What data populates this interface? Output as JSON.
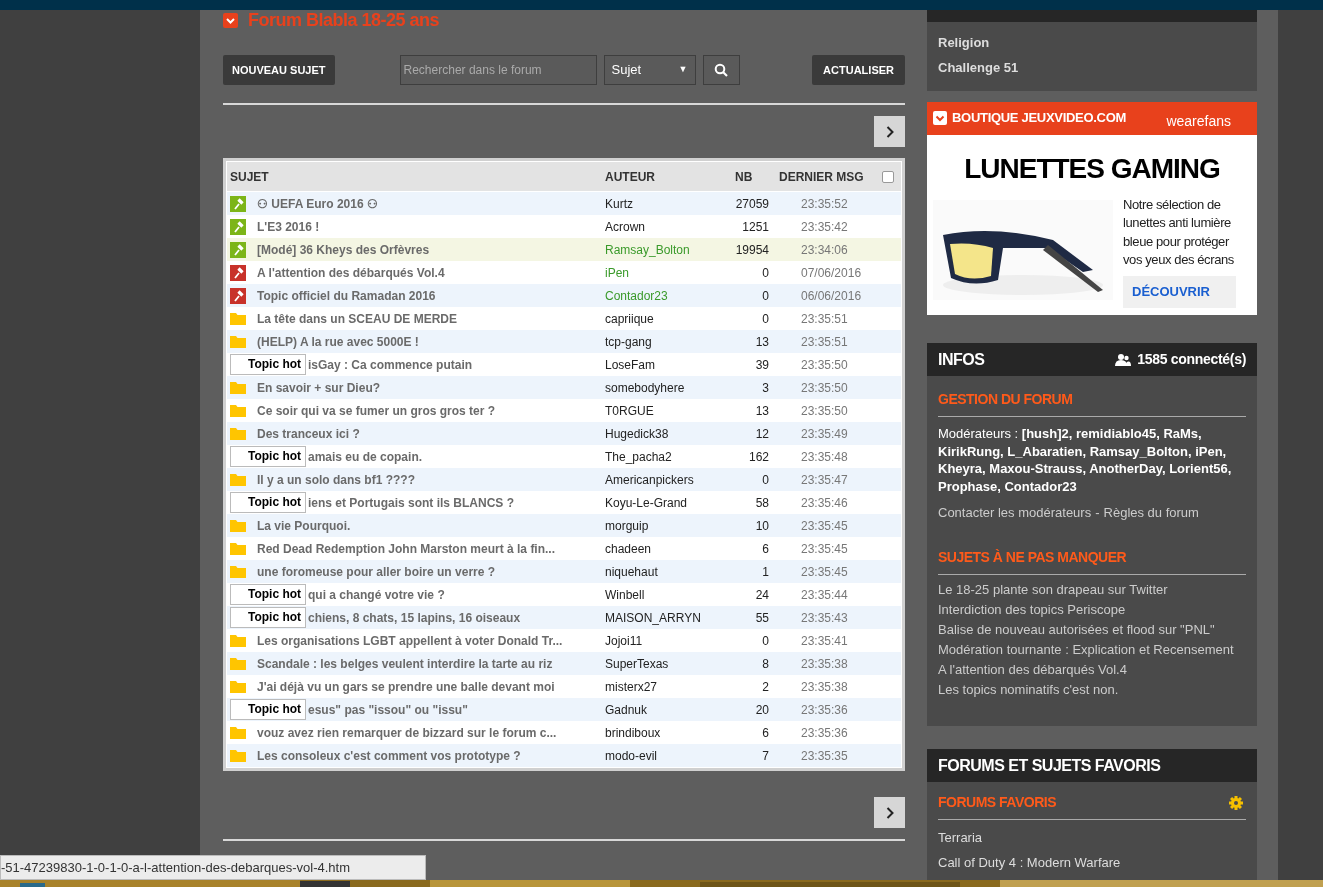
{
  "page_title": "Forum Blabla 18-25 ans",
  "toolbar": {
    "new_topic": "NOUVEAU SUJET",
    "search": {
      "placeholder": "Rechercher dans le forum"
    },
    "select": {
      "value": "Sujet",
      "arrow": "▼"
    },
    "refresh": "ACTUALISER"
  },
  "table": {
    "columns": [
      "SUJET",
      "AUTEUR",
      "NB",
      "DERNIER MSG"
    ],
    "select_all": {
      "checked": false
    },
    "rows": [
      {
        "kind": "pinned_open",
        "title": "⚇ UEFA Euro 2016 ⚇",
        "author": "Kurtz",
        "moderator": false,
        "highlighted": false,
        "count": "27059",
        "last": "23:35:52"
      },
      {
        "kind": "pinned_open",
        "title": "L'E3 2016 !",
        "author": "Acrown",
        "moderator": false,
        "highlighted": false,
        "count": "1251",
        "last": "23:35:42"
      },
      {
        "kind": "pinned_open",
        "title": "[Modé] 36 Kheys des Orfèvres",
        "author": "Ramsay_Bolton",
        "moderator": true,
        "highlighted": true,
        "count": "19954",
        "last": "23:34:06"
      },
      {
        "kind": "pinned_locked",
        "title": "A l'attention des débarqués Vol.4",
        "author": "iPen",
        "moderator": true,
        "highlighted": false,
        "count": "0",
        "last": "07/06/2016"
      },
      {
        "kind": "pinned_locked",
        "title": "Topic officiel du Ramadan 2016",
        "author": "Contador23",
        "moderator": true,
        "highlighted": false,
        "count": "0",
        "last": "06/06/2016"
      },
      {
        "kind": "folder",
        "title": "La tête dans un SCEAU DE MERDE",
        "author": "capriique",
        "moderator": false,
        "highlighted": false,
        "count": "0",
        "last": "23:35:51"
      },
      {
        "kind": "folder",
        "title": "(HELP) A la rue avec 5000E !",
        "author": "tcp-gang",
        "moderator": false,
        "highlighted": false,
        "count": "13",
        "last": "23:35:51"
      },
      {
        "kind": "hot",
        "icon_alt": "Topic hot",
        "title": "isGay : Ca commence putain",
        "author": "LoseFam",
        "moderator": false,
        "highlighted": false,
        "count": "39",
        "last": "23:35:50"
      },
      {
        "kind": "folder",
        "title": "En savoir + sur Dieu?",
        "author": "somebodyhere",
        "moderator": false,
        "highlighted": false,
        "count": "3",
        "last": "23:35:50"
      },
      {
        "kind": "folder",
        "title": "Ce soir qui va se fumer un gros gros ter ?",
        "author": "T0RGUE",
        "moderator": false,
        "highlighted": false,
        "count": "13",
        "last": "23:35:50"
      },
      {
        "kind": "folder",
        "title": "Des tranceux ici ?",
        "author": "Hugedick38",
        "moderator": false,
        "highlighted": false,
        "count": "12",
        "last": "23:35:49"
      },
      {
        "kind": "hot",
        "icon_alt": "Topic hot",
        "title": "amais eu de copain.",
        "author": "The_pacha2",
        "moderator": false,
        "highlighted": false,
        "count": "162",
        "last": "23:35:48"
      },
      {
        "kind": "folder",
        "title": "Il y a un solo dans bf1 ????",
        "author": "Americanpickers",
        "moderator": false,
        "highlighted": false,
        "count": "0",
        "last": "23:35:47"
      },
      {
        "kind": "hot",
        "icon_alt": "Topic hot",
        "title": "iens et Portugais sont ils BLANCS ?",
        "author": "Koyu-Le-Grand",
        "moderator": false,
        "highlighted": false,
        "count": "58",
        "last": "23:35:46"
      },
      {
        "kind": "folder",
        "title": "La vie Pourquoi.",
        "author": "morguip",
        "moderator": false,
        "highlighted": false,
        "count": "10",
        "last": "23:35:45"
      },
      {
        "kind": "folder",
        "title": "Red Dead Redemption John Marston meurt à la fin...",
        "author": "chadeen",
        "moderator": false,
        "highlighted": false,
        "count": "6",
        "last": "23:35:45"
      },
      {
        "kind": "folder",
        "title": "une foromeuse pour aller boire un verre ?",
        "author": "niquehaut",
        "moderator": false,
        "highlighted": false,
        "count": "1",
        "last": "23:35:45"
      },
      {
        "kind": "hot",
        "icon_alt": "Topic hot",
        "title": "qui a changé votre vie ?",
        "author": "Winbell",
        "moderator": false,
        "highlighted": false,
        "count": "24",
        "last": "23:35:44"
      },
      {
        "kind": "hot",
        "icon_alt": "Topic hot",
        "title": "chiens, 8 chats, 15 lapins, 16 oiseaux",
        "author": "MAISON_ARRYN",
        "moderator": false,
        "highlighted": false,
        "count": "55",
        "last": "23:35:43"
      },
      {
        "kind": "folder",
        "title": "Les organisations LGBT appellent à voter Donald Tr...",
        "author": "Jojoi11",
        "moderator": false,
        "highlighted": false,
        "count": "0",
        "last": "23:35:41"
      },
      {
        "kind": "folder",
        "title": "Scandale : les belges veulent interdire la tarte au riz",
        "author": "SuperTexas",
        "moderator": false,
        "highlighted": false,
        "count": "8",
        "last": "23:35:38"
      },
      {
        "kind": "folder",
        "title": "J'ai déjà vu un gars se prendre une balle devant moi",
        "author": "misterx27",
        "moderator": false,
        "highlighted": false,
        "count": "2",
        "last": "23:35:38"
      },
      {
        "kind": "hot",
        "icon_alt": "Topic hot",
        "title": "esus\" pas \"issou\" ou \"issu\"",
        "author": "Gadnuk",
        "moderator": false,
        "highlighted": false,
        "count": "20",
        "last": "23:35:36"
      },
      {
        "kind": "folder",
        "title": "vouz avez rien remarquer de bizzard sur le forum c...",
        "author": "brindiboux",
        "moderator": false,
        "highlighted": false,
        "count": "6",
        "last": "23:35:36"
      },
      {
        "kind": "folder",
        "title": "Les consoleux c'est comment vos prototype ?",
        "author": "modo-evil",
        "moderator": false,
        "highlighted": false,
        "count": "7",
        "last": "23:35:35"
      }
    ]
  },
  "subforums": {
    "items": [
      "Religion",
      "Challenge 51"
    ]
  },
  "ad": {
    "brand": "BOUTIQUE JEUXVIDEO.COM",
    "partner": "wearefans",
    "headline": "LUNETTES GAMING",
    "text": "Notre sélection de lunettes anti lumière bleue pour protéger vos yeux des écrans",
    "cta": "DÉCOUVRIR"
  },
  "infos": {
    "title": "INFOS",
    "online": "1585 connecté(s)",
    "management_heading": "GESTION DU FORUM",
    "moderators": "Modérateurs : **[hush]2, remidiablo45, RaMs, KirikRung, L_Abaratien, Ramsay_Bolton, iPen, Kheyra, Maxou-Strauss, AnotherDay, Lorient56, Prophase, Contador23**",
    "contact": "Contacter les modérateurs",
    "separator": "-",
    "rules": "Règles du forum",
    "must_read_heading": "SUJETS À NE PAS MANQUER",
    "must_read": [
      "Le 18-25 plante son drapeau sur Twitter",
      "Interdiction des topics Periscope",
      "Balise de nouveau autorisées et flood sur \"PNL\"",
      "Modération tournante : Explication et Recensement",
      "A l'attention des débarqués Vol.4",
      "Les topics nominatifs c'est non."
    ]
  },
  "favorites": {
    "title": "FORUMS ET SUJETS FAVORIS",
    "forums_heading": "FORUMS FAVORIS",
    "forums": [
      "Terraria",
      "Call of Duty 4 : Modern Warfare"
    ]
  },
  "status_url": "-51-47239830-1-0-1-0-a-l-attention-des-debarques-vol-4.htm"
}
